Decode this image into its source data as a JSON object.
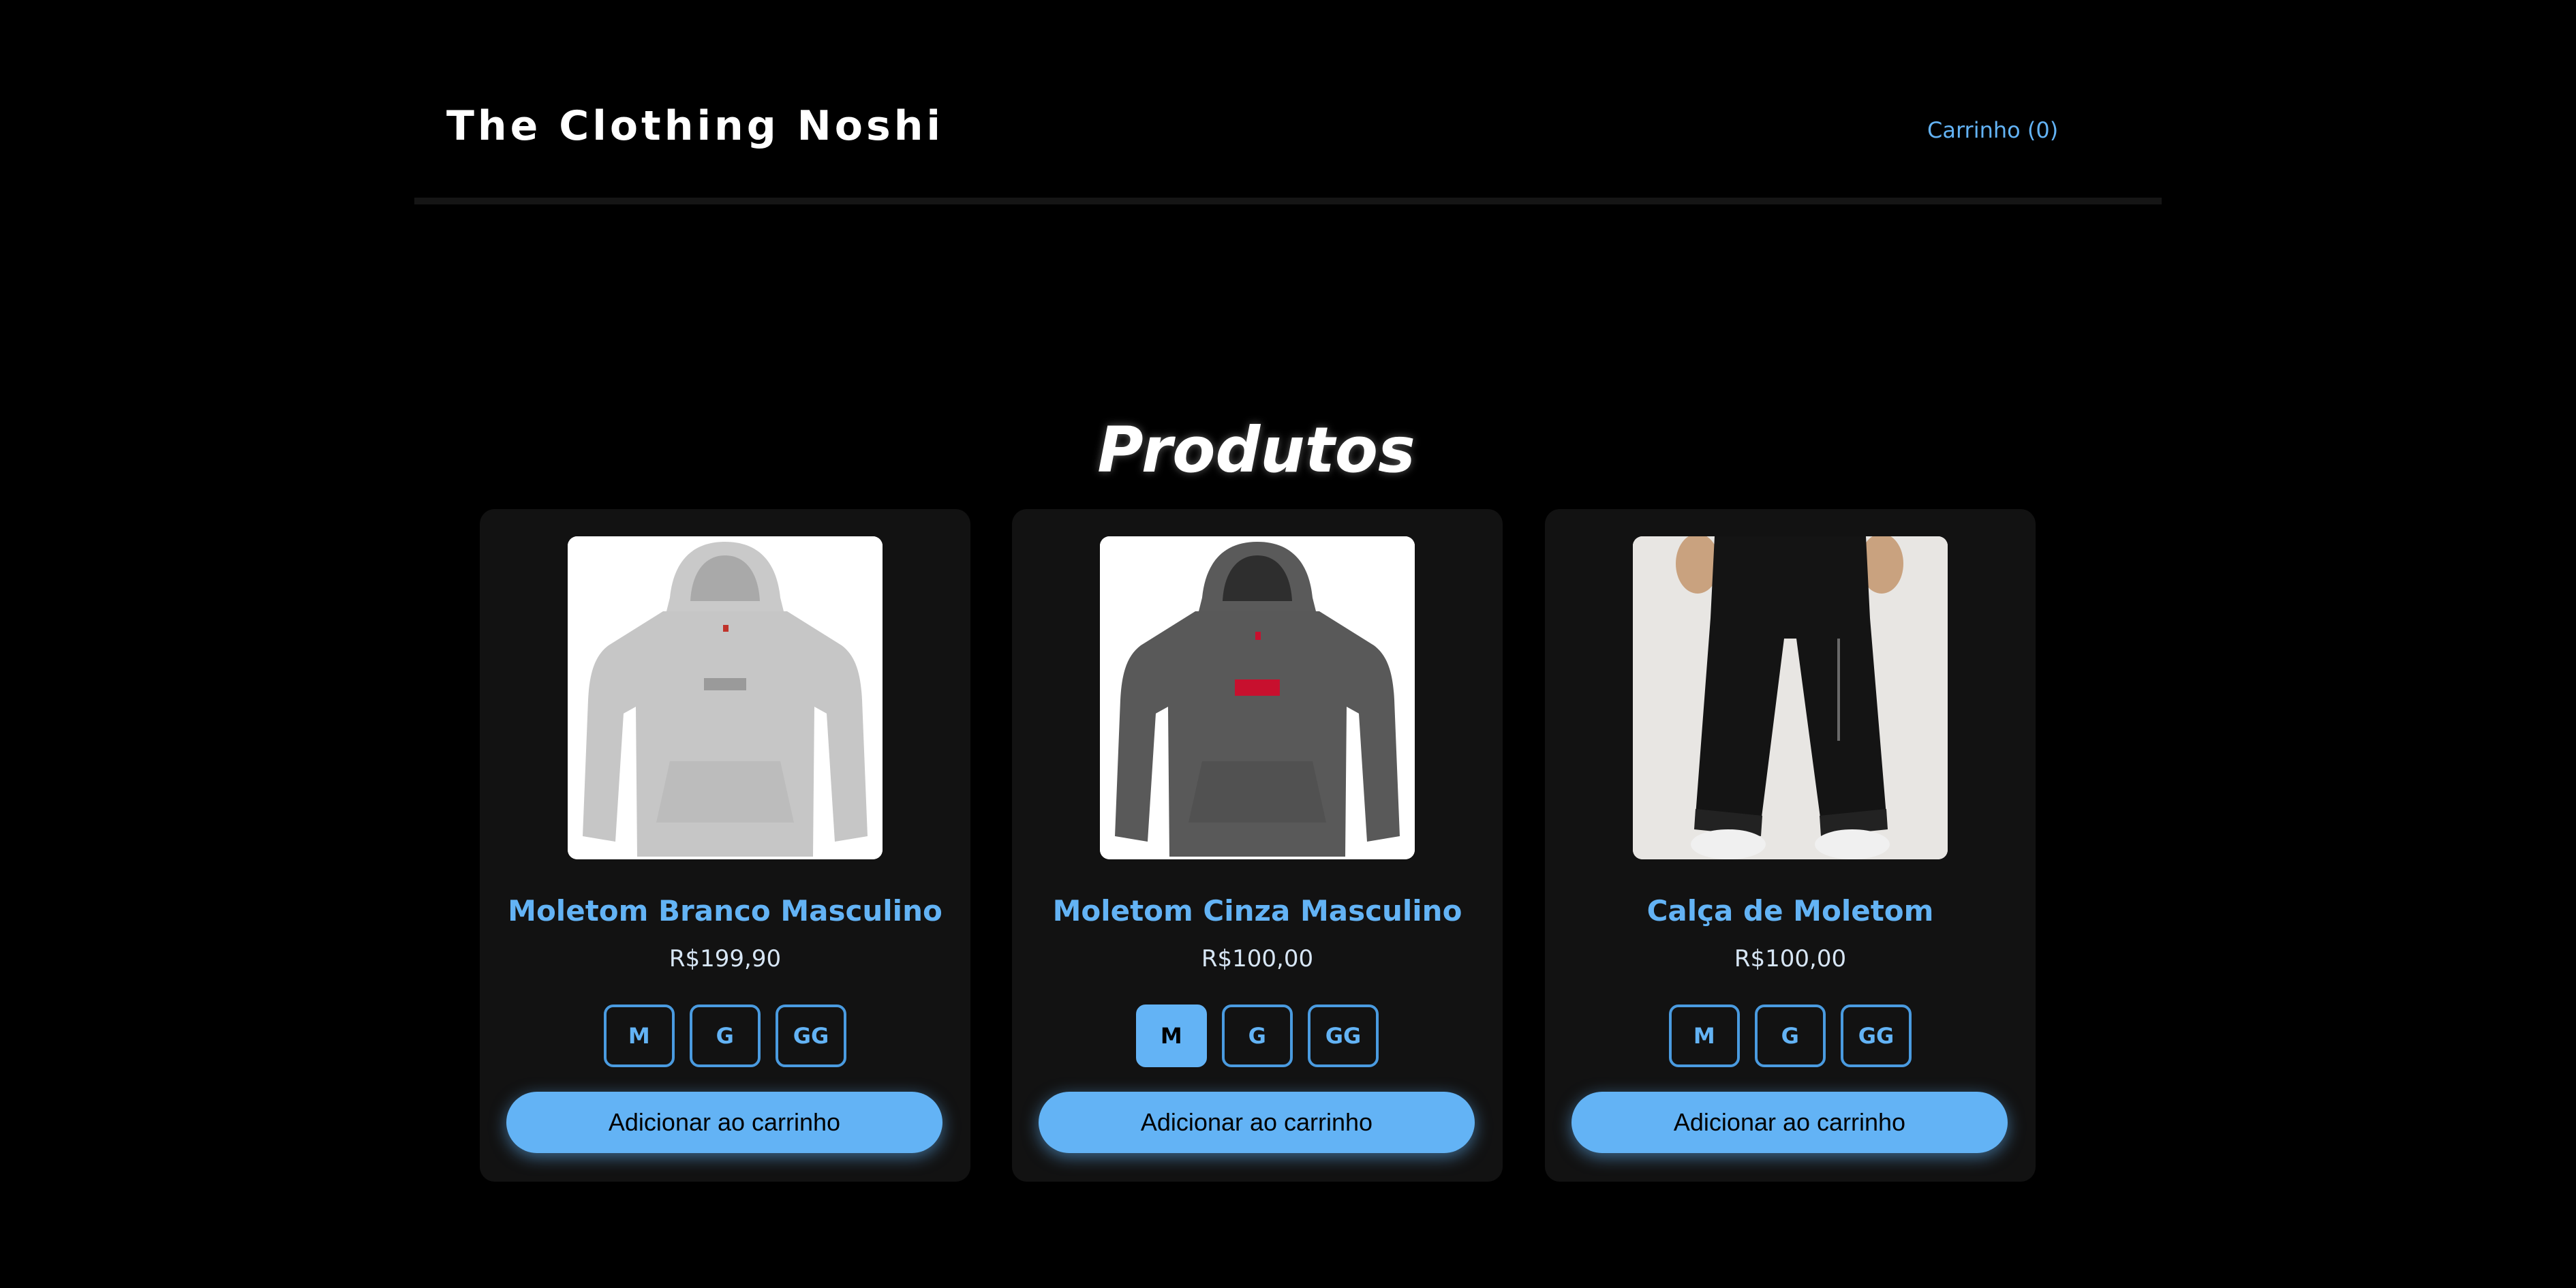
{
  "header": {
    "brand": "The Clothing Noshi",
    "cart_label": "Carrinho (0)"
  },
  "main": {
    "title": "Produtos"
  },
  "colors": {
    "accent": "#63b3f5",
    "background": "#000000",
    "card": "#121212"
  },
  "products": [
    {
      "name": "Moletom Branco Masculino",
      "price": "R$199,90",
      "image_icon": "grey-hoodie-photo",
      "sizes": [
        "M",
        "G",
        "GG"
      ],
      "selected_size": null,
      "add_label": "Adicionar ao carrinho"
    },
    {
      "name": "Moletom Cinza Masculino",
      "price": "R$100,00",
      "image_icon": "dark-grey-hoodie-photo",
      "sizes": [
        "M",
        "G",
        "GG"
      ],
      "selected_size": "M",
      "add_label": "Adicionar ao carrinho"
    },
    {
      "name": "Calça de Moletom",
      "price": "R$100,00",
      "image_icon": "black-sweatpants-photo",
      "sizes": [
        "M",
        "G",
        "GG"
      ],
      "selected_size": null,
      "add_label": "Adicionar ao carrinho"
    }
  ]
}
